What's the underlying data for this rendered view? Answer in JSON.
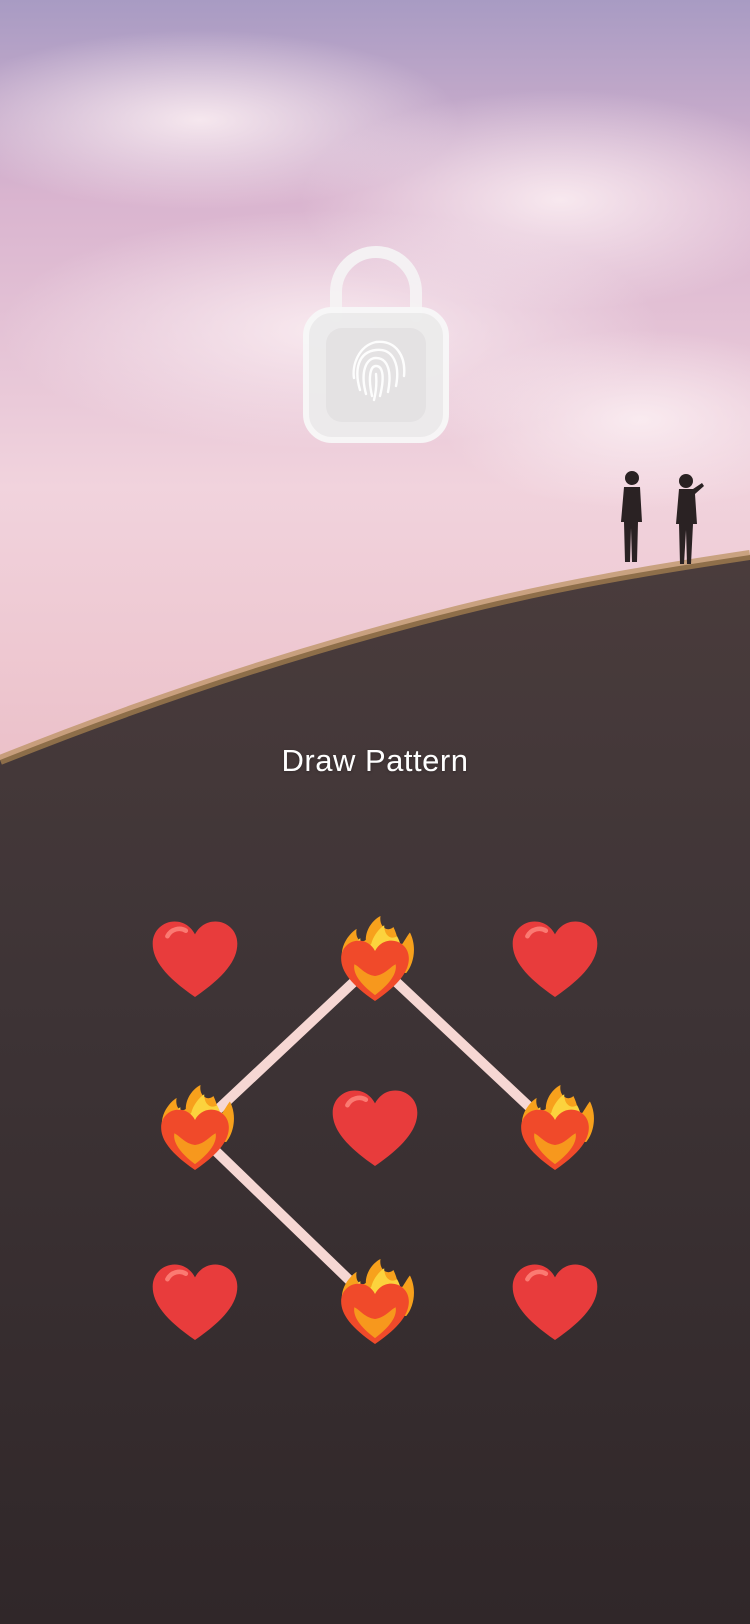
{
  "title": "Draw Pattern",
  "icons": {
    "lock": "padlock-fingerprint-icon",
    "node_idle": "red-heart-icon",
    "node_active": "heart-on-fire-icon"
  },
  "colors": {
    "sky_top": "#b3a5c8",
    "sky_pink": "#e8b7c7",
    "hill": "#3c3234",
    "heart": "#e83c3c",
    "connector": "#f6d7d3"
  },
  "pattern": {
    "nodes": [
      {
        "id": 1,
        "state": "idle"
      },
      {
        "id": 2,
        "state": "active"
      },
      {
        "id": 3,
        "state": "idle"
      },
      {
        "id": 4,
        "state": "active"
      },
      {
        "id": 5,
        "state": "idle"
      },
      {
        "id": 6,
        "state": "active"
      },
      {
        "id": 7,
        "state": "idle"
      },
      {
        "id": 8,
        "state": "active"
      },
      {
        "id": 9,
        "state": "idle"
      }
    ],
    "path": [
      6,
      2,
      4,
      8
    ]
  }
}
